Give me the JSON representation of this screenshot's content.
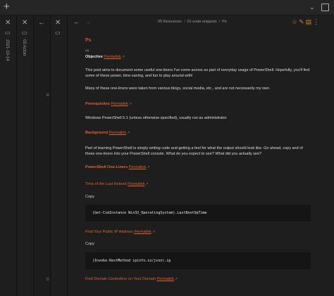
{
  "topbar": {
    "new_tab_icon": "plus-icon",
    "tab_list_icon": "chevron-down-icon",
    "layout_icon": "layout-icon"
  },
  "pane1": {
    "title": "2021-10-14",
    "side_letter": ""
  },
  "pane2": {
    "title": "05 Acton"
  },
  "pane3": {
    "left_letters": [
      "R",
      "D"
    ]
  },
  "navbar": {
    "breadcrumb": [
      "05 Resources",
      "01-code-snippets",
      "Ps"
    ]
  },
  "note": {
    "title": "Ps",
    "hash": "##",
    "objective_label": "Objective",
    "permalink": "Permalink",
    "intro": "This post aims to document some useful one-liners I've come across as part of everyday usage of PowerShell. Hopefully, you'll find some of these power, time-saving, and fun to play around with!",
    "intro2": "Many of these one-liners were taken from various blogs, social media, etc., and are not necessarily my own.",
    "prereq_heading": "Prerequisites",
    "prereq_text": "Windows PowerShell 5.1 (unless otherwise specified), usually run as administrator",
    "background_heading": "Background",
    "background_text": "Part of learning PowerShell is simply writing code and getting a feel for what the output should look like. Go ahead, copy and of these one-liners into your PowerShell console. What do you expect to see? What did you actually see?",
    "oneliners_heading": "PowerShell One-Liners",
    "items": [
      {
        "title": "Time of the Last Reboot",
        "copy": "Copy",
        "code": "(Get-CimInstance Win32_OperatingSystem).LastBootUpTime"
      },
      {
        "title": "Find Your Public IP Address",
        "copy": "Copy",
        "code": "(Invoke-RestMethod ipinfo.io/json).ip"
      },
      {
        "title": "Find Domain Controllers on Your Domain"
      }
    ]
  },
  "colors": {
    "accent": "#e0622e",
    "title_red": "#e24a2a",
    "bg": "#1e1e1e",
    "code_bg": "#151515"
  }
}
